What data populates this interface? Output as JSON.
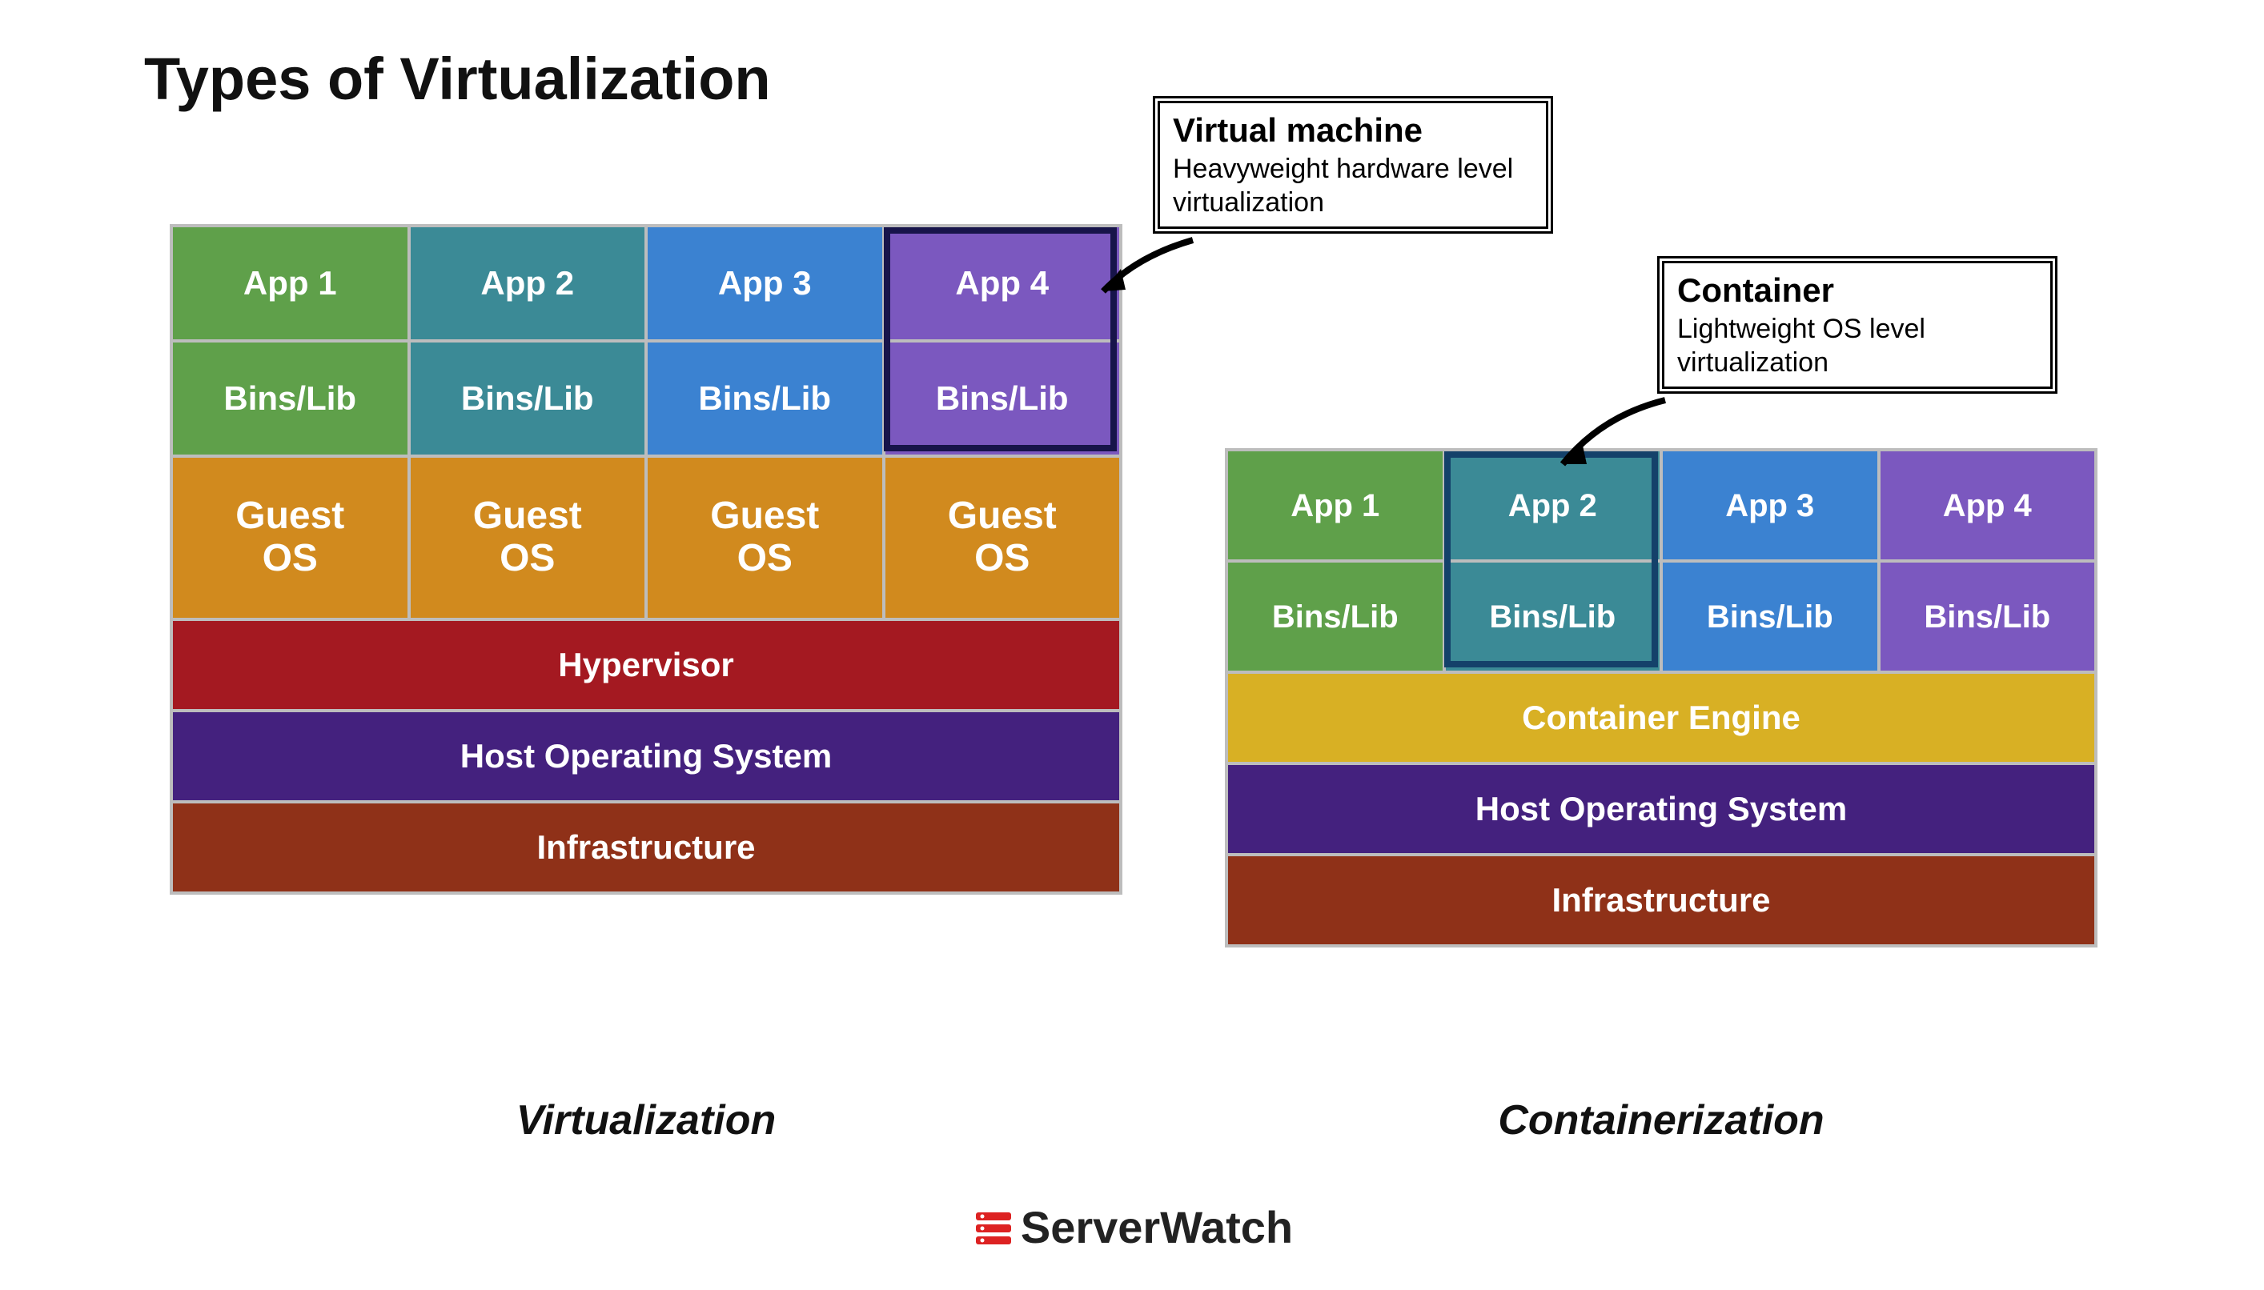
{
  "title": "Types of Virtualization",
  "virtualization": {
    "caption": "Virtualization",
    "apps": [
      "App 1",
      "App 2",
      "App 3",
      "App 4"
    ],
    "bins": [
      "Bins/Lib",
      "Bins/Lib",
      "Bins/Lib",
      "Bins/Lib"
    ],
    "guests": [
      "Guest OS",
      "Guest OS",
      "Guest OS",
      "Guest OS"
    ],
    "layers": {
      "hypervisor": "Hypervisor",
      "host_os": "Host Operating System",
      "infrastructure": "Infrastructure"
    },
    "callout": {
      "title": "Virtual machine",
      "subtitle": "Heavyweight hardware level virtualization"
    }
  },
  "containerization": {
    "caption": "Containerization",
    "apps": [
      "App 1",
      "App 2",
      "App 3",
      "App 4"
    ],
    "bins": [
      "Bins/Lib",
      "Bins/Lib",
      "Bins/Lib",
      "Bins/Lib"
    ],
    "layers": {
      "engine": "Container Engine",
      "host_os": "Host Operating System",
      "infrastructure": "Infrastructure"
    },
    "callout": {
      "title": "Container",
      "subtitle": "Lightweight OS level virtualization"
    }
  },
  "brand": "ServerWatch"
}
